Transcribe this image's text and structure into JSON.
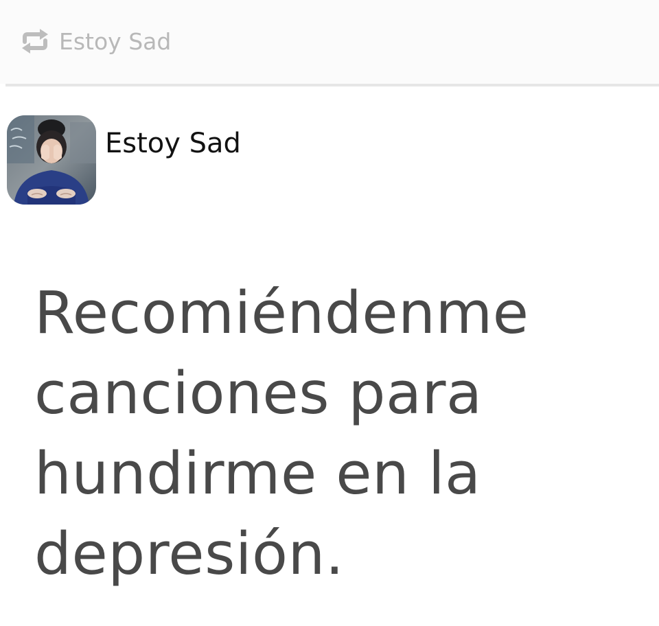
{
  "reblog": {
    "icon": "reblog-icon",
    "blog_name": "Estoy Sad"
  },
  "post": {
    "author": {
      "name": "Estoy Sad",
      "avatar": "avatar-image"
    },
    "text": "Recomiéndenme canciones para hundirme en la depresión."
  },
  "colors": {
    "reblog_text": "#b8b8b8",
    "author_text": "#121212",
    "post_text": "#494949",
    "divider": "#e6e6e6"
  }
}
